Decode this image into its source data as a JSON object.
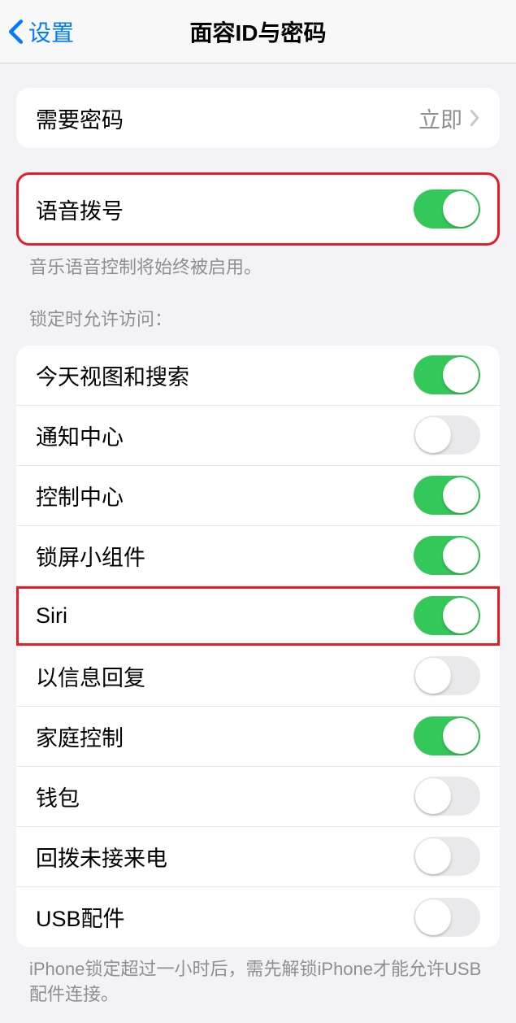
{
  "header": {
    "back_label": "设置",
    "title": "面容ID与密码"
  },
  "passcode_group": {
    "require_label": "需要密码",
    "require_value": "立即"
  },
  "voice_dial": {
    "label": "语音拨号",
    "on": true,
    "footer": "音乐语音控制将始终被启用。"
  },
  "locked_access": {
    "header": "锁定时允许访问：",
    "items": [
      {
        "label": "今天视图和搜索",
        "on": true
      },
      {
        "label": "通知中心",
        "on": false
      },
      {
        "label": "控制中心",
        "on": true
      },
      {
        "label": "锁屏小组件",
        "on": true
      },
      {
        "label": "Siri",
        "on": true
      },
      {
        "label": "以信息回复",
        "on": false
      },
      {
        "label": "家庭控制",
        "on": true
      },
      {
        "label": "钱包",
        "on": false
      },
      {
        "label": "回拨未接来电",
        "on": false
      },
      {
        "label": "USB配件",
        "on": false
      }
    ],
    "footer": "iPhone锁定超过一小时后，需先解锁iPhone才能允许USB配件连接。"
  }
}
